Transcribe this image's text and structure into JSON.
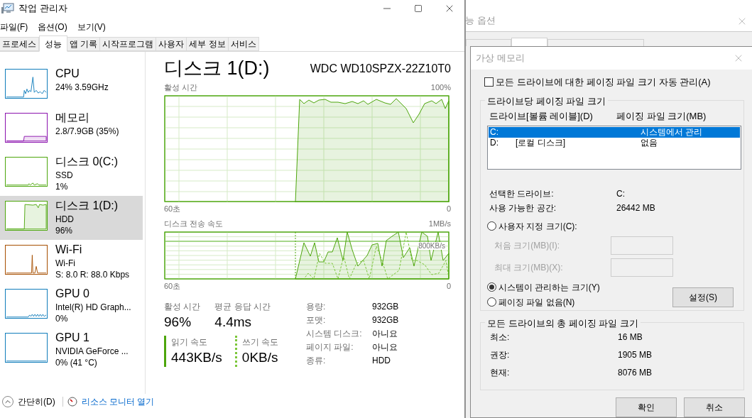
{
  "task_manager": {
    "title": "작업 관리자",
    "menu": [
      "파일(F)",
      "옵션(O)",
      "보기(V)"
    ],
    "tabs": [
      {
        "label": "프로세스",
        "selected": false
      },
      {
        "label": "성능",
        "selected": true
      },
      {
        "label": "앱 기록",
        "selected": false
      },
      {
        "label": "시작프로그램",
        "selected": false
      },
      {
        "label": "사용자",
        "selected": false
      },
      {
        "label": "세부 정보",
        "selected": false
      },
      {
        "label": "서비스",
        "selected": false
      }
    ],
    "sidebar": [
      {
        "name": "CPU",
        "line_1": "24% 3.59GHz",
        "color": "#117dbb",
        "selected": false
      },
      {
        "name": "메모리",
        "line_1": "2.8/7.9GB (35%)",
        "color": "#8b12ae",
        "selected": false
      },
      {
        "name": "디스크 0(C:)",
        "line_1": "SSD",
        "line_2": "1%",
        "color": "#4da60c",
        "selected": false
      },
      {
        "name": "디스크 1(D:)",
        "line_1": "HDD",
        "line_2": "96%",
        "color": "#4da60c",
        "selected": true
      },
      {
        "name": "Wi-Fi",
        "line_1": "Wi-Fi",
        "line_2": "S: 8.0 R: 88.0 Kbps",
        "color": "#a74f01",
        "selected": false
      },
      {
        "name": "GPU 0",
        "line_1": "Intel(R) HD Graph...",
        "line_2": "0%",
        "color": "#117dbb",
        "selected": false
      },
      {
        "name": "GPU 1",
        "line_1": "NVIDIA GeForce ...",
        "line_2": "0% (41 °C)",
        "color": "#117dbb",
        "selected": false
      }
    ],
    "detail": {
      "title": "디스크 1(D:)",
      "model": "WDC WD10SPZX-22Z10T0",
      "active_chart": {
        "label": "활성 시간",
        "max": "100%",
        "x_start": "60초",
        "x_end": "0"
      },
      "transfer_chart": {
        "label": "디스크 전송 속도",
        "max": "1MB/s",
        "mid": "800KB/s",
        "x_start": "60초",
        "x_end": "0"
      },
      "stats": [
        {
          "label": "활성 시간",
          "value": "96%"
        },
        {
          "label": "평균 응답 시간",
          "value": "4.4ms"
        }
      ],
      "speeds": [
        {
          "label": "읽기 속도",
          "value": "443KB/s",
          "kind": "solid"
        },
        {
          "label": "쓰기 속도",
          "value": "0KB/s",
          "kind": "dashed"
        }
      ],
      "properties": [
        {
          "label": "용량:",
          "value": "932GB"
        },
        {
          "label": "포맷:",
          "value": "932GB"
        },
        {
          "label": "시스템 디스크:",
          "value": "아니요"
        },
        {
          "label": "페이지 파일:",
          "value": "아니요"
        },
        {
          "label": "종류:",
          "value": "HDD"
        }
      ]
    },
    "footer": {
      "fewer_details": "간단히(D)",
      "resource_monitor": "리소스 모니터 열기"
    }
  },
  "performance_options": {
    "title": "능 옵션",
    "tabs": [
      {
        "selected": false
      },
      {
        "selected": true
      },
      {
        "selected": false
      }
    ]
  },
  "virtual_memory": {
    "title": "가상 메모리",
    "auto_manage": {
      "label": "모든 드라이브에 대한 페이징 파일 크기 자동 관리(A)",
      "checked": false
    },
    "per_drive_group": "드라이브당 페이징 파일 크기",
    "columns": [
      "드라이브[볼륨 레이블](D)",
      "페이징 파일 크기(MB)"
    ],
    "drives": [
      {
        "drive": "C:",
        "size": "시스템에서 관리",
        "selected": true
      },
      {
        "drive": "D:",
        "label": "[로컬 디스크]",
        "size": "없음",
        "selected": false
      }
    ],
    "info": [
      {
        "label": "선택한 드라이브:",
        "value": "C:"
      },
      {
        "label": "사용 가능한 공간:",
        "value": "26442 MB"
      }
    ],
    "options": [
      {
        "label": "사용자 지정 크기(C):",
        "selected": false
      },
      {
        "label": "시스템이 관리하는 크기(Y)",
        "selected": true
      },
      {
        "label": "페이징 파일 없음(N)",
        "selected": false
      }
    ],
    "size_fields": [
      {
        "label": "처음 크기(MB)(I):",
        "disabled": true
      },
      {
        "label": "최대 크기(MB)(X):",
        "disabled": true
      }
    ],
    "set_button": "설정(S)",
    "total_group": "모든 드라이브의 총 페이징 파일 크기",
    "totals": [
      {
        "label": "최소:",
        "value": "16 MB"
      },
      {
        "label": "권장:",
        "value": "1905 MB"
      },
      {
        "label": "현재:",
        "value": "8076 MB"
      }
    ],
    "buttons": [
      "확인",
      "취소"
    ]
  }
}
